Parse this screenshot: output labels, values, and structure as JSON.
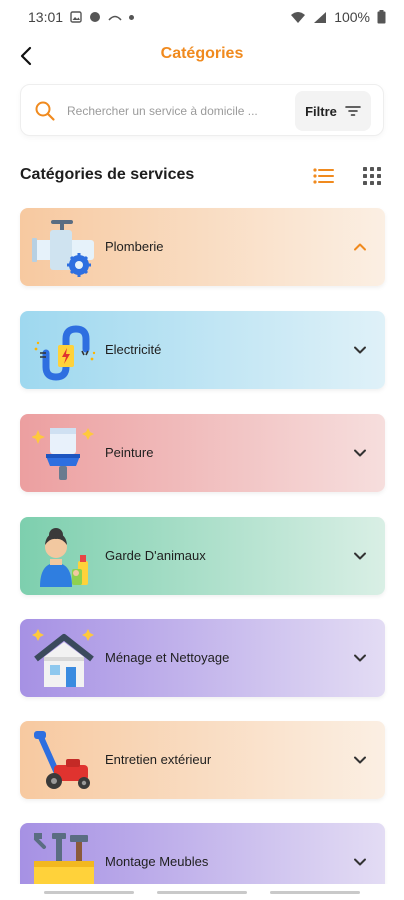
{
  "status_bar": {
    "time": "13:01",
    "battery": "100%"
  },
  "header": {
    "title": "Catégories"
  },
  "search": {
    "placeholder": "Rechercher un service à domicile ...",
    "filter_label": "Filtre"
  },
  "section": {
    "title": "Catégories de services"
  },
  "colors": {
    "accent": "#f08a1e"
  },
  "categories": [
    {
      "label": "Plomberie",
      "icon": "plumbing-icon",
      "expanded": true,
      "gradient": [
        "#f7c9a0",
        "#fbefe3"
      ]
    },
    {
      "label": "Electricité",
      "icon": "electricity-icon",
      "expanded": false,
      "gradient": [
        "#9ed8ef",
        "#dff1f8"
      ]
    },
    {
      "label": "Peinture",
      "icon": "paint-icon",
      "expanded": false,
      "gradient": [
        "#ec9fa0",
        "#f6dedd"
      ]
    },
    {
      "label": "Garde D'animaux",
      "icon": "pet-care-icon",
      "expanded": false,
      "gradient": [
        "#7dcfae",
        "#d9efe5"
      ]
    },
    {
      "label": "Ménage et Nettoyage",
      "icon": "cleaning-icon",
      "expanded": false,
      "gradient": [
        "#a691e4",
        "#e3dcf4"
      ]
    },
    {
      "label": "Entretien extérieur",
      "icon": "lawn-mower-icon",
      "expanded": false,
      "gradient": [
        "#f7c9a0",
        "#fbefe3"
      ]
    },
    {
      "label": "Montage Meubles",
      "icon": "tools-icon",
      "expanded": false,
      "gradient": [
        "#a691e4",
        "#e3dcf4"
      ]
    }
  ]
}
